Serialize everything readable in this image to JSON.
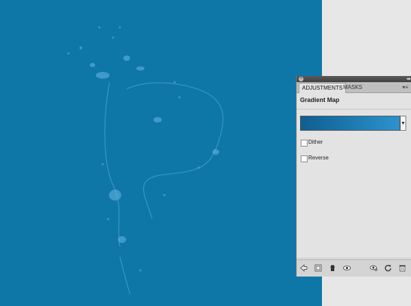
{
  "panel": {
    "tabs": [
      "ADJUSTMENTS",
      "MASKS"
    ],
    "active_tab": "ADJUSTMENTS",
    "title": "Gradient Map",
    "gradient_colors": [
      "#0f5e90",
      "#2c93cf"
    ],
    "options": [
      {
        "label": "Dither",
        "checked": false
      },
      {
        "label": "Reverse",
        "checked": false
      }
    ],
    "footer_icons": [
      "back-arrow-icon",
      "expanded-view-icon",
      "clip-layer-icon",
      "visibility-eye-icon",
      "view-previous-icon",
      "reset-icon",
      "trash-icon"
    ]
  },
  "canvas": {
    "background": "#0f76a8",
    "artwork": "water splash letter"
  }
}
